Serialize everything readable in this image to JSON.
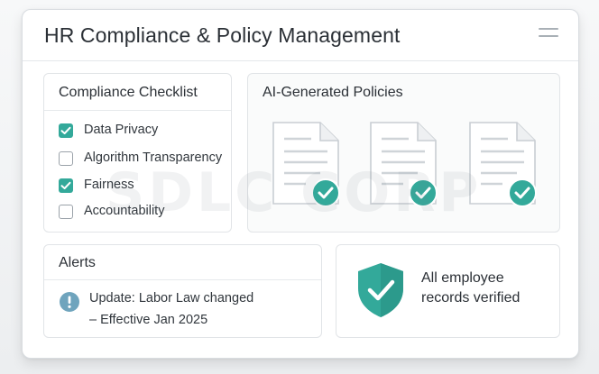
{
  "header": {
    "title": "HR Compliance & Policy Management",
    "menu_icon": "hamburger-menu-icon"
  },
  "checklist": {
    "title": "Compliance Checklist",
    "items": [
      {
        "label": "Data Privacy",
        "checked": true
      },
      {
        "label": "Algorithm Transparency",
        "checked": false
      },
      {
        "label": "Fairness",
        "checked": true
      },
      {
        "label": "Accountability",
        "checked": false
      }
    ]
  },
  "policies": {
    "title": "AI-Generated Policies",
    "documents": [
      {
        "icon": "document-icon",
        "status": "verified-check-icon"
      },
      {
        "icon": "document-icon",
        "status": "verified-check-icon"
      },
      {
        "icon": "document-icon",
        "status": "verified-check-icon"
      }
    ]
  },
  "alerts": {
    "title": "Alerts",
    "icon": "info-icon",
    "line1": "Update: Labor Law changed",
    "line2": "– Effective Jan 2025"
  },
  "verified": {
    "icon": "shield-check-icon",
    "line1": "All employee",
    "line2": "records verified"
  },
  "watermark": "SDLC CORP",
  "colors": {
    "accent_teal": "#33a99a",
    "info_blue": "#6fa4bd",
    "text_dark": "#2b3036"
  }
}
